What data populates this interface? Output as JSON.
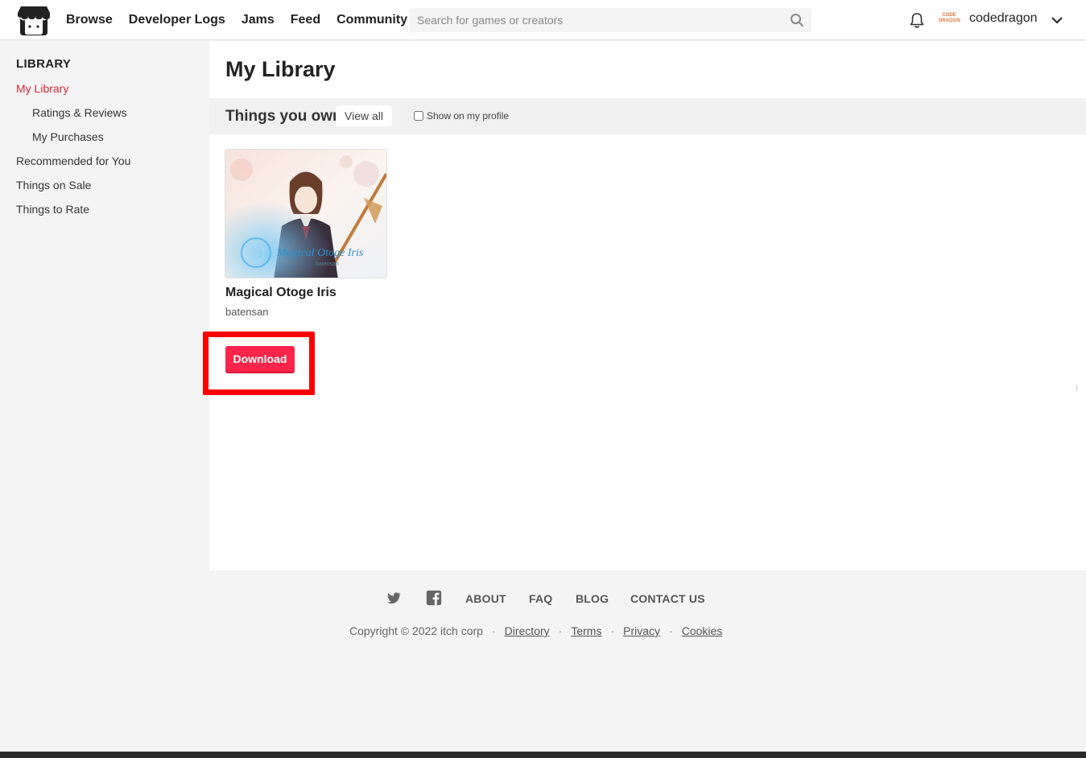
{
  "header": {
    "nav": [
      "Browse",
      "Developer Logs",
      "Jams",
      "Feed",
      "Community"
    ],
    "search_placeholder": "Search for games or creators",
    "username": "codedragon",
    "avatar_text": "CODE DRAGON"
  },
  "sidebar": {
    "heading": "LIBRARY",
    "items": [
      {
        "label": "My Library",
        "active": true
      },
      {
        "label": "Ratings & Reviews"
      },
      {
        "label": "My Purchases"
      },
      {
        "label": "Recommended for You"
      },
      {
        "label": "Things on Sale"
      },
      {
        "label": "Things to Rate"
      }
    ]
  },
  "main": {
    "title": "My Library",
    "section_title": "Things you own",
    "view_all": "View all",
    "show_on_profile": "Show on my profile",
    "game": {
      "title": "Magical Otoge Iris",
      "author": "batensan",
      "cover_text": "Magical Otoge Iris",
      "cover_subtext": "batensan",
      "download": "Download"
    }
  },
  "footer": {
    "links": [
      "ABOUT",
      "FAQ",
      "BLOG",
      "CONTACT US"
    ],
    "copyright": "Copyright © 2022 itch corp",
    "sub_links": [
      "Directory",
      "Terms",
      "Privacy",
      "Cookies"
    ]
  },
  "colors": {
    "accent": "#d9283c",
    "download_button": "#ff2449",
    "highlight_box": "#ff0000"
  }
}
